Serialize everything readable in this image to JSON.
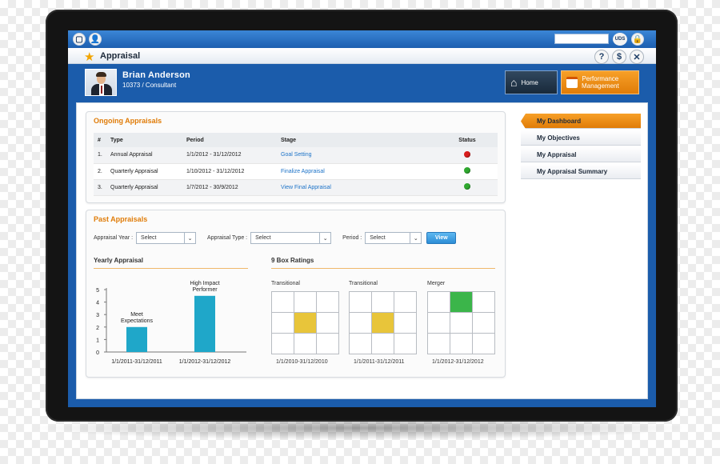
{
  "window": {
    "title": "Appraisal",
    "uds_label": "UDS"
  },
  "user": {
    "name": "Brian Anderson",
    "id_role": "10373 / Consultant"
  },
  "nav": {
    "home_label": "Home",
    "perf_label_line1": "Performance",
    "perf_label_line2": "Management"
  },
  "ongoing": {
    "title": "Ongoing Appraisals",
    "headers": [
      "#",
      "Type",
      "Period",
      "Stage",
      "Status"
    ],
    "rows": [
      {
        "num": "1.",
        "type": "Annual Appraisal",
        "period": "1/1/2012 - 31/12/2012",
        "stage": "Goal Setting",
        "status_color": "#d81c1c"
      },
      {
        "num": "2.",
        "type": "Quarterly Appraisal",
        "period": "1/10/2012 - 31/12/2012",
        "stage": "Finalize Appraisal",
        "status_color": "#2fa82f"
      },
      {
        "num": "3.",
        "type": "Quarterly Appraisal",
        "period": "1/7/2012 - 30/9/2012",
        "stage": "View Final Appraisal",
        "status_color": "#2fa82f"
      }
    ]
  },
  "past": {
    "title": "Past Appraisals",
    "filters": {
      "year_label": "Appraisal Year :",
      "year_value": "Select",
      "type_label": "Appraisal Type :",
      "type_value": "Select",
      "period_label": "Period :",
      "period_value": "Select",
      "view_label": "View"
    },
    "yearly_title": "Yearly Appraisal",
    "ninebox_title": "9 Box Ratings",
    "grids": [
      {
        "label": "Transitional",
        "period": "1/1/2010-31/12/2010",
        "row": 1,
        "col": 1,
        "color": "#e8c53a"
      },
      {
        "label": "Transitional",
        "period": "1/1/2011-31/12/2011",
        "row": 1,
        "col": 1,
        "color": "#e8c53a"
      },
      {
        "label": "Merger",
        "period": "1/1/2012-31/12/2012",
        "row": 0,
        "col": 1,
        "color": "#3bb54a"
      }
    ]
  },
  "chart_data": {
    "type": "bar",
    "categories": [
      "1/1/2011-31/12/2011",
      "1/1/2012-31/12/2012"
    ],
    "values": [
      2,
      4.5
    ],
    "bar_labels": [
      [
        "Meet",
        "Expectations"
      ],
      [
        "High Impact",
        "Performer"
      ]
    ],
    "yticks": [
      "0",
      "1",
      "2",
      "3",
      "4",
      "5"
    ],
    "ylim": [
      0,
      5
    ],
    "bar_color": "#1fa7c9"
  },
  "sidemenu": {
    "items": [
      "My Dashboard",
      "My Objectives",
      "My Appraisal",
      "My Appraisal Summary"
    ]
  },
  "colors": {
    "accent": "#e07c08",
    "brand": "#1b5cab",
    "link": "#1d73c8"
  }
}
